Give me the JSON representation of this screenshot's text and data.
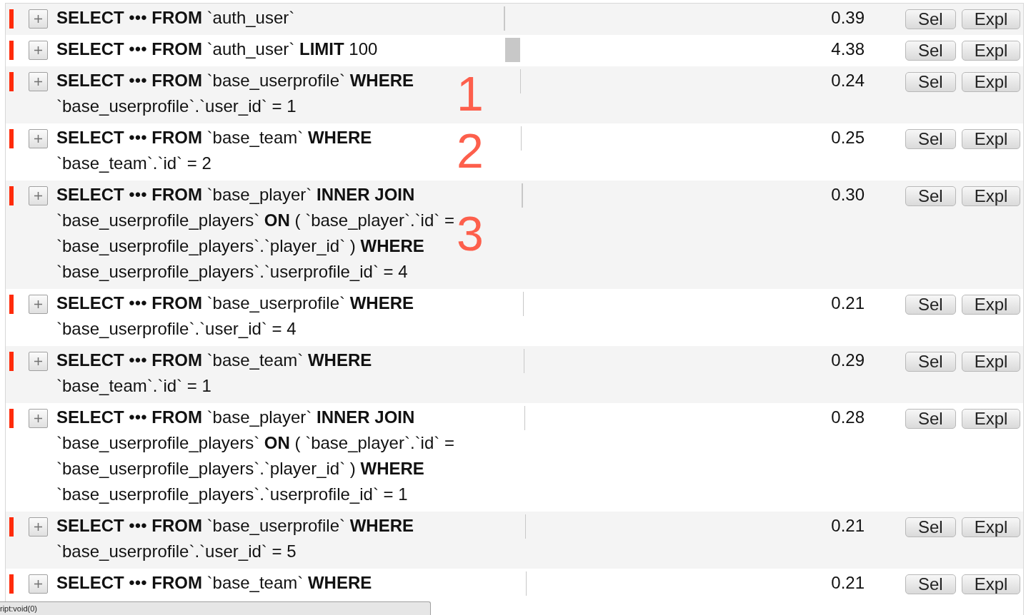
{
  "rows": [
    {
      "color": "#ff2b0a",
      "expanded": false,
      "sql": "**SELECT** ••• **FROM** `auth_user`",
      "time": "0.39",
      "buttons": [
        "Sel",
        "Expl"
      ]
    },
    {
      "color": "#ff2b0a",
      "expanded": false,
      "sql": "**SELECT** ••• **FROM** `auth_user` **LIMIT** 100",
      "time": "4.38",
      "buttons": [
        "Sel",
        "Expl"
      ]
    },
    {
      "color": "#ff2b0a",
      "expanded": false,
      "sql": "**SELECT** ••• **FROM** `base_userprofile` **WHERE** `base_userprofile`.`user_id` = 1",
      "annotation": "1",
      "time": "0.24",
      "buttons": [
        "Sel",
        "Expl"
      ]
    },
    {
      "color": "#ff2b0a",
      "expanded": false,
      "sql": "**SELECT** ••• **FROM** `base_team` **WHERE** `base_team`.`id` = 2",
      "annotation": "2",
      "time": "0.25",
      "buttons": [
        "Sel",
        "Expl"
      ]
    },
    {
      "color": "#ff2b0a",
      "expanded": false,
      "sql": "**SELECT** ••• **FROM** `base_player` **INNER JOIN** `base_userprofile_players` **ON** ( `base_player`.`id` = `base_userprofile_players`.`player_id` ) **WHERE** `base_userprofile_players`.`userprofile_id` = 4",
      "annotation": "3",
      "time": "0.30",
      "buttons": [
        "Sel",
        "Expl"
      ]
    },
    {
      "color": "#ff2b0a",
      "expanded": false,
      "sql": "**SELECT** ••• **FROM** `base_userprofile` **WHERE** `base_userprofile`.`user_id` = 4",
      "time": "0.21",
      "buttons": [
        "Sel",
        "Expl"
      ]
    },
    {
      "color": "#ff2b0a",
      "expanded": false,
      "sql": "**SELECT** ••• **FROM** `base_team` **WHERE** `base_team`.`id` = 1",
      "time": "0.29",
      "buttons": [
        "Sel",
        "Expl"
      ]
    },
    {
      "color": "#ff2b0a",
      "expanded": false,
      "sql": "**SELECT** ••• **FROM** `base_player` **INNER JOIN** `base_userprofile_players` **ON** ( `base_player`.`id` = `base_userprofile_players`.`player_id` ) **WHERE** `base_userprofile_players`.`userprofile_id` = 1",
      "time": "0.28",
      "buttons": [
        "Sel",
        "Expl"
      ]
    },
    {
      "color": "#ff2b0a",
      "expanded": false,
      "sql": "**SELECT** ••• **FROM** `base_userprofile` **WHERE** `base_userprofile`.`user_id` = 5",
      "time": "0.21",
      "buttons": [
        "Sel",
        "Expl"
      ]
    },
    {
      "color": "#ff2b0a",
      "expanded": false,
      "sql": "**SELECT** ••• **FROM** `base_team` **WHERE**",
      "time": "0.21",
      "buttons": [
        "Sel",
        "Expl"
      ]
    }
  ],
  "status_bar": {
    "text": "ript:void(0)"
  }
}
